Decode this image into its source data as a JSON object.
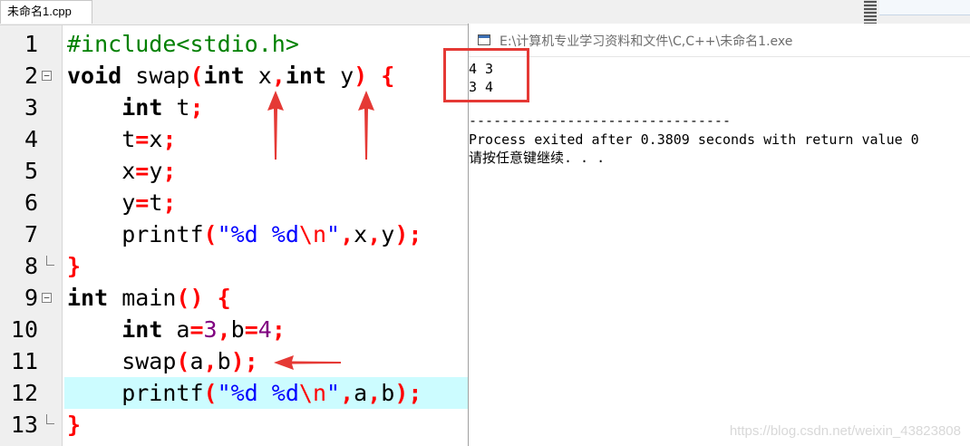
{
  "tab": {
    "label": "未命名1.cpp"
  },
  "editor": {
    "lines": [
      {
        "n": "1",
        "tokens": [
          {
            "t": "#include<stdio.h>",
            "c": "pp"
          }
        ]
      },
      {
        "n": "2",
        "fold": "open",
        "tokens": [
          {
            "t": "void",
            "c": "kw"
          },
          {
            "t": " swap",
            "c": "id"
          },
          {
            "t": "(",
            "c": "sym"
          },
          {
            "t": "int",
            "c": "kw"
          },
          {
            "t": " x",
            "c": "id"
          },
          {
            "t": ",",
            "c": "sym"
          },
          {
            "t": "int",
            "c": "kw"
          },
          {
            "t": " y",
            "c": "id"
          },
          {
            "t": ")",
            "c": "sym"
          },
          {
            "t": " ",
            "c": "id"
          },
          {
            "t": "{",
            "c": "sym"
          }
        ]
      },
      {
        "n": "3",
        "tokens": [
          {
            "t": "    ",
            "c": "id"
          },
          {
            "t": "int",
            "c": "kw"
          },
          {
            "t": " t",
            "c": "id"
          },
          {
            "t": ";",
            "c": "sym"
          }
        ]
      },
      {
        "n": "4",
        "tokens": [
          {
            "t": "    t",
            "c": "id"
          },
          {
            "t": "=",
            "c": "sym"
          },
          {
            "t": "x",
            "c": "id"
          },
          {
            "t": ";",
            "c": "sym"
          }
        ]
      },
      {
        "n": "5",
        "tokens": [
          {
            "t": "    x",
            "c": "id"
          },
          {
            "t": "=",
            "c": "sym"
          },
          {
            "t": "y",
            "c": "id"
          },
          {
            "t": ";",
            "c": "sym"
          }
        ]
      },
      {
        "n": "6",
        "tokens": [
          {
            "t": "    y",
            "c": "id"
          },
          {
            "t": "=",
            "c": "sym"
          },
          {
            "t": "t",
            "c": "id"
          },
          {
            "t": ";",
            "c": "sym"
          }
        ]
      },
      {
        "n": "7",
        "tokens": [
          {
            "t": "    printf",
            "c": "id"
          },
          {
            "t": "(",
            "c": "sym"
          },
          {
            "t": "\"%d %d",
            "c": "str"
          },
          {
            "t": "\\n",
            "c": "esc"
          },
          {
            "t": "\"",
            "c": "str"
          },
          {
            "t": ",",
            "c": "sym"
          },
          {
            "t": "x",
            "c": "id"
          },
          {
            "t": ",",
            "c": "sym"
          },
          {
            "t": "y",
            "c": "id"
          },
          {
            "t": ");",
            "c": "sym"
          }
        ]
      },
      {
        "n": "8",
        "fold": "end",
        "tokens": [
          {
            "t": "}",
            "c": "sym"
          }
        ]
      },
      {
        "n": "9",
        "fold": "open",
        "tokens": [
          {
            "t": "int",
            "c": "kw"
          },
          {
            "t": " main",
            "c": "id"
          },
          {
            "t": "()",
            "c": "sym"
          },
          {
            "t": " ",
            "c": "id"
          },
          {
            "t": "{",
            "c": "sym"
          }
        ]
      },
      {
        "n": "10",
        "tokens": [
          {
            "t": "    ",
            "c": "id"
          },
          {
            "t": "int",
            "c": "kw"
          },
          {
            "t": " a",
            "c": "id"
          },
          {
            "t": "=",
            "c": "sym"
          },
          {
            "t": "3",
            "c": "num"
          },
          {
            "t": ",",
            "c": "sym"
          },
          {
            "t": "b",
            "c": "id"
          },
          {
            "t": "=",
            "c": "sym"
          },
          {
            "t": "4",
            "c": "num"
          },
          {
            "t": ";",
            "c": "sym"
          }
        ]
      },
      {
        "n": "11",
        "tokens": [
          {
            "t": "    swap",
            "c": "id"
          },
          {
            "t": "(",
            "c": "sym"
          },
          {
            "t": "a",
            "c": "id"
          },
          {
            "t": ",",
            "c": "sym"
          },
          {
            "t": "b",
            "c": "id"
          },
          {
            "t": ");",
            "c": "sym"
          }
        ]
      },
      {
        "n": "12",
        "current": true,
        "tokens": [
          {
            "t": "    printf",
            "c": "id"
          },
          {
            "t": "(",
            "c": "sym"
          },
          {
            "t": "\"%d %d",
            "c": "str"
          },
          {
            "t": "\\n",
            "c": "esc"
          },
          {
            "t": "\"",
            "c": "str"
          },
          {
            "t": ",",
            "c": "sym"
          },
          {
            "t": "a",
            "c": "id"
          },
          {
            "t": ",",
            "c": "sym"
          },
          {
            "t": "b",
            "c": "id"
          },
          {
            "t": ");",
            "c": "sym"
          }
        ]
      },
      {
        "n": "13",
        "fold": "end",
        "tokens": [
          {
            "t": "}",
            "c": "sym"
          }
        ]
      }
    ]
  },
  "console": {
    "title": "E:\\计算机专业学习资料和文件\\C,C++\\未命名1.exe",
    "output": [
      "4 3",
      "3 4",
      "",
      "--------------------------------",
      "Process exited after 0.3809 seconds with return value 0",
      "请按任意键继续. . ."
    ]
  },
  "colors": {
    "keyword": "#000000",
    "preprocessor": "#008000",
    "symbol": "#ff0000",
    "number": "#800080",
    "string": "#0000ff",
    "current_line": "#ccfcff",
    "annotation": "#e53935"
  },
  "icons": {
    "console": "console-window-icon",
    "fold_open": "fold-minus-icon",
    "fold_end": "fold-end-icon"
  },
  "watermark": "https://blog.csdn.net/weixin_43823808"
}
